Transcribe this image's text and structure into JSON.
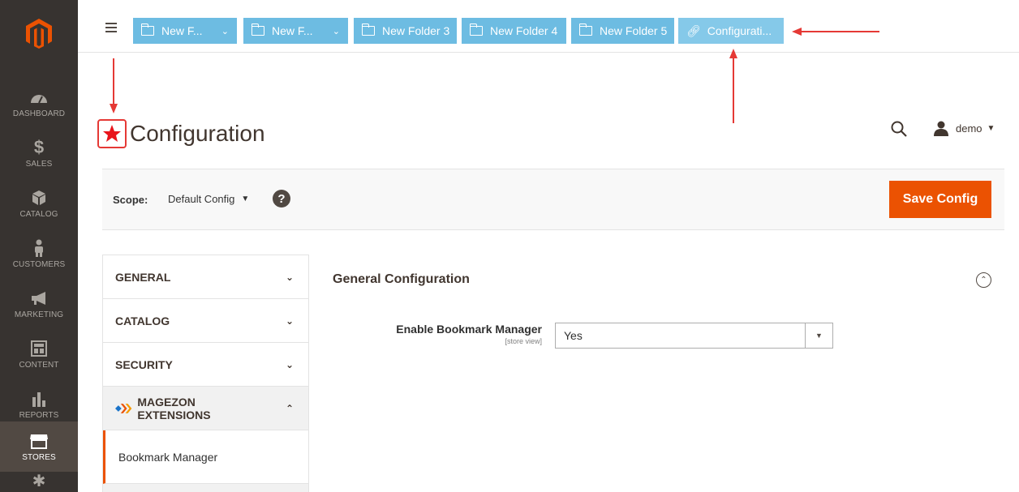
{
  "sidebar": {
    "items": [
      {
        "label": "DASHBOARD",
        "icon": "dashboard-icon"
      },
      {
        "label": "SALES",
        "icon": "dollar-icon"
      },
      {
        "label": "CATALOG",
        "icon": "cube-icon"
      },
      {
        "label": "CUSTOMERS",
        "icon": "person-icon"
      },
      {
        "label": "MARKETING",
        "icon": "megaphone-icon"
      },
      {
        "label": "CONTENT",
        "icon": "layout-icon"
      },
      {
        "label": "REPORTS",
        "icon": "bar-chart-icon"
      },
      {
        "label": "STORES",
        "icon": "store-icon"
      }
    ]
  },
  "tabs": [
    {
      "label": "New F...",
      "icon": "folder-icon",
      "dropdown": true
    },
    {
      "label": "New F...",
      "icon": "folder-icon",
      "dropdown": true
    },
    {
      "label": "New Folder 3",
      "icon": "folder-icon",
      "dropdown": false
    },
    {
      "label": "New Folder 4",
      "icon": "folder-icon",
      "dropdown": false
    },
    {
      "label": "New Folder 5",
      "icon": "folder-icon",
      "dropdown": false
    },
    {
      "label": "Configurati...",
      "icon": "link-icon",
      "dropdown": false
    }
  ],
  "header": {
    "title": "Configuration",
    "user": "demo"
  },
  "scope": {
    "label": "Scope:",
    "value": "Default Config",
    "help": "?",
    "save_label": "Save Config"
  },
  "config_nav": {
    "items": [
      {
        "label": "GENERAL"
      },
      {
        "label": "CATALOG"
      },
      {
        "label": "SECURITY"
      },
      {
        "label": "MAGEZON EXTENSIONS"
      }
    ],
    "sub_item": "Bookmark Manager"
  },
  "section": {
    "title": "General Configuration",
    "field_label": "Enable Bookmark Manager",
    "field_scope": "[store view]",
    "field_value": "Yes"
  },
  "colors": {
    "sidebar": "#373330",
    "tab": "#6dbce2",
    "accent": "#eb5202",
    "annotation": "#e53935"
  }
}
